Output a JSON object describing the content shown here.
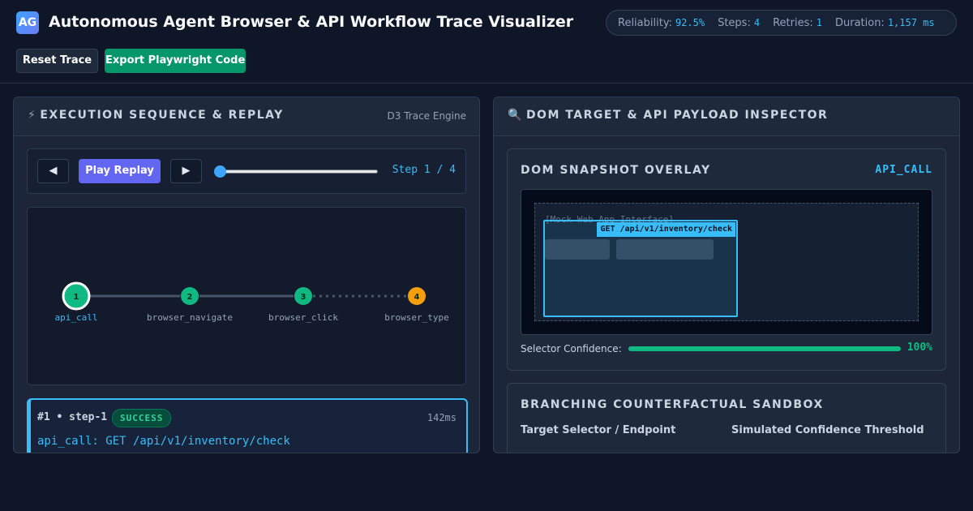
{
  "header": {
    "logo_text": "AG",
    "title": "Autonomous Agent Browser & API Workflow Trace Visualizer",
    "stats": [
      {
        "label": "Reliability:",
        "value": "92.5%"
      },
      {
        "label": "Steps:",
        "value": "4"
      },
      {
        "label": "Retries:",
        "value": "1"
      },
      {
        "label": "Duration:",
        "value": "1,157 ms"
      }
    ],
    "reset_label": "Reset Trace",
    "export_label": "Export Playwright Code"
  },
  "left_panel": {
    "icon": "lightning-icon",
    "title": "EXECUTION SEQUENCE & REPLAY",
    "tag": "D3 Trace Engine",
    "controls": {
      "prev_label": "◀",
      "play_label": "Play Replay",
      "next_label": "▶",
      "step_text": "Step 1 / 4",
      "slider_value": 1,
      "slider_max": 4
    },
    "nodes": [
      {
        "num": "1",
        "label": "api_call",
        "status": "active",
        "color": "#10b981"
      },
      {
        "num": "2",
        "label": "browser_navigate",
        "status": "success",
        "color": "#10b981"
      },
      {
        "num": "3",
        "label": "browser_click",
        "status": "success",
        "color": "#10b981"
      },
      {
        "num": "4",
        "label": "browser_type",
        "status": "warning",
        "color": "#f59e0b"
      }
    ],
    "step_card": {
      "id": "#1 • step-1",
      "status": "SUCCESS",
      "duration": "142ms",
      "detail": "api_call: GET /api/v1/inventory/check"
    }
  },
  "right_panel": {
    "icon": "magnifier-icon",
    "title": "DOM TARGET & API PAYLOAD INSPECTOR",
    "dom": {
      "title": "DOM SNAPSHOT OVERLAY",
      "action_type": "API_CALL",
      "mock_label": "[Mock Web App Interface]",
      "highlight_label": "GET /api/v1/inventory/check",
      "confidence_label": "Selector Confidence:",
      "confidence_value": "100%",
      "confidence_fraction": 1.0
    },
    "sandbox": {
      "title": "BRANCHING COUNTERFACTUAL SANDBOX",
      "target_label": "Target Selector / Endpoint",
      "threshold_label": "Simulated Confidence Threshold"
    }
  },
  "colors": {
    "accent": "#38bdf8",
    "success": "#10b981",
    "warning": "#f59e0b",
    "play": "#6366f1"
  }
}
